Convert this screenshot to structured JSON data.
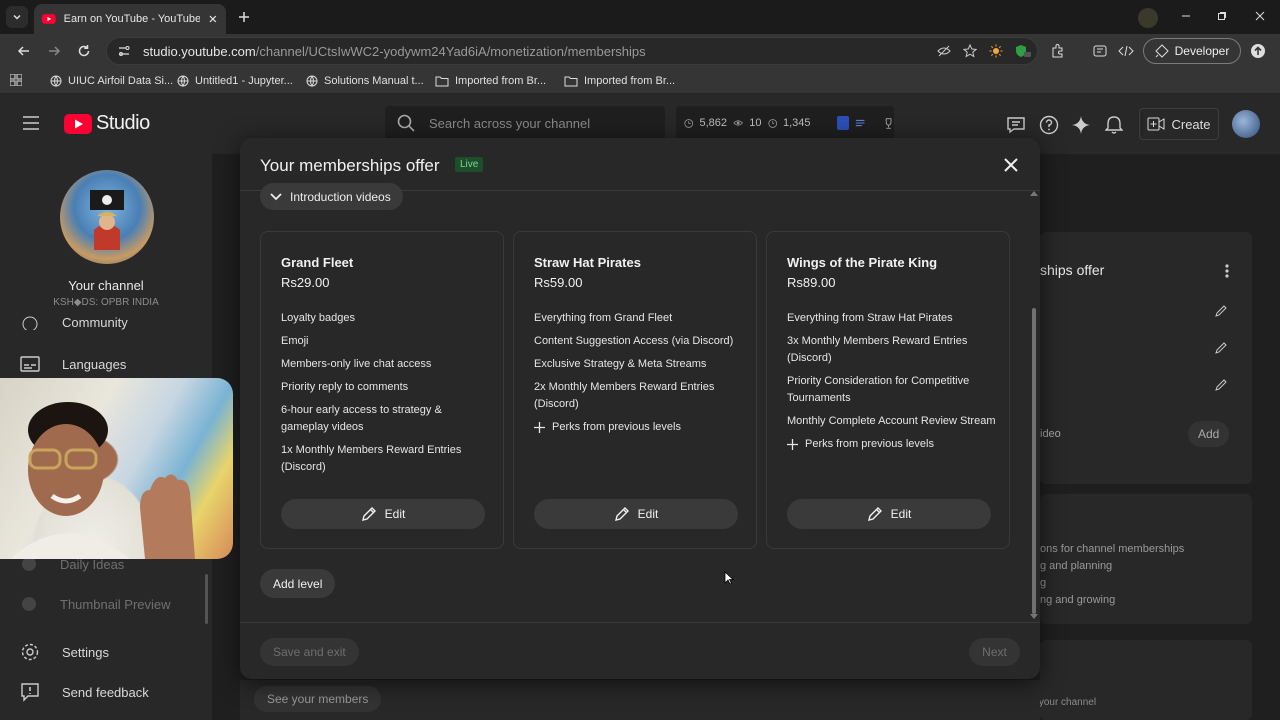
{
  "browser": {
    "tab_title": "Earn on YouTube - YouTube Stu",
    "url_host": "studio.youtube.com",
    "url_path": "/channel/UCtsIwWC2-yodywm24Yad6iA/monetization/memberships",
    "developer_label": "Developer",
    "bookmarks": [
      "UIUC Airfoil Data Si...",
      "Untitled1 - Jupyter...",
      "Solutions Manual t...",
      "Imported from Br...",
      "Imported from Br..."
    ]
  },
  "studio": {
    "logo_text": "Studio",
    "search_placeholder": "Search across your channel",
    "stats": {
      "views": "5,862",
      "watching": "10",
      "other": "1,345"
    },
    "create_label": "Create"
  },
  "sidebar": {
    "channel_label": "Your channel",
    "channel_handle": "KSH◆DS: OPBR INDIA",
    "items": [
      {
        "label": "Community"
      },
      {
        "label": "Languages"
      },
      {
        "label": "Daily Ideas"
      },
      {
        "label": "Thumbnail Preview"
      },
      {
        "label": "Settings"
      },
      {
        "label": "Send feedback"
      }
    ]
  },
  "background": {
    "card_title": "ships offer",
    "intro_text": "ideo",
    "add_label": "Add",
    "lines": [
      "ons for channel memberships",
      "g and planning",
      "g",
      "ng and growing"
    ],
    "bottom_text": "Invite viewers to join your channel",
    "see_members": "See your members"
  },
  "modal": {
    "title": "Your memberships offer",
    "badge": "Live",
    "intro_chip": "Introduction videos",
    "tiers": [
      {
        "name": "Grand Fleet",
        "price": "Rs29.00",
        "perks": [
          "Loyalty badges",
          "Emoji",
          "Members-only live chat access",
          "Priority reply to comments",
          "6-hour early access to strategy & gameplay videos",
          "1x Monthly Members Reward Entries (Discord)"
        ],
        "edit": "Edit"
      },
      {
        "name": "Straw Hat Pirates",
        "price": "Rs59.00",
        "perks": [
          "Everything from Grand Fleet",
          "Content Suggestion Access (via Discord)",
          "Exclusive Strategy & Meta Streams",
          "2x Monthly Members Reward Entries (Discord)"
        ],
        "prev": "Perks from previous levels",
        "edit": "Edit"
      },
      {
        "name": "Wings of the Pirate King",
        "price": "Rs89.00",
        "perks": [
          "Everything from Straw Hat Pirates",
          "3x Monthly Members Reward Entries (Discord)",
          "Priority Consideration for Competitive Tournaments",
          "Monthly Complete Account Review Stream"
        ],
        "prev": "Perks from previous levels",
        "edit": "Edit"
      }
    ],
    "add_level": "Add level",
    "save_exit": "Save and exit",
    "next": "Next"
  }
}
